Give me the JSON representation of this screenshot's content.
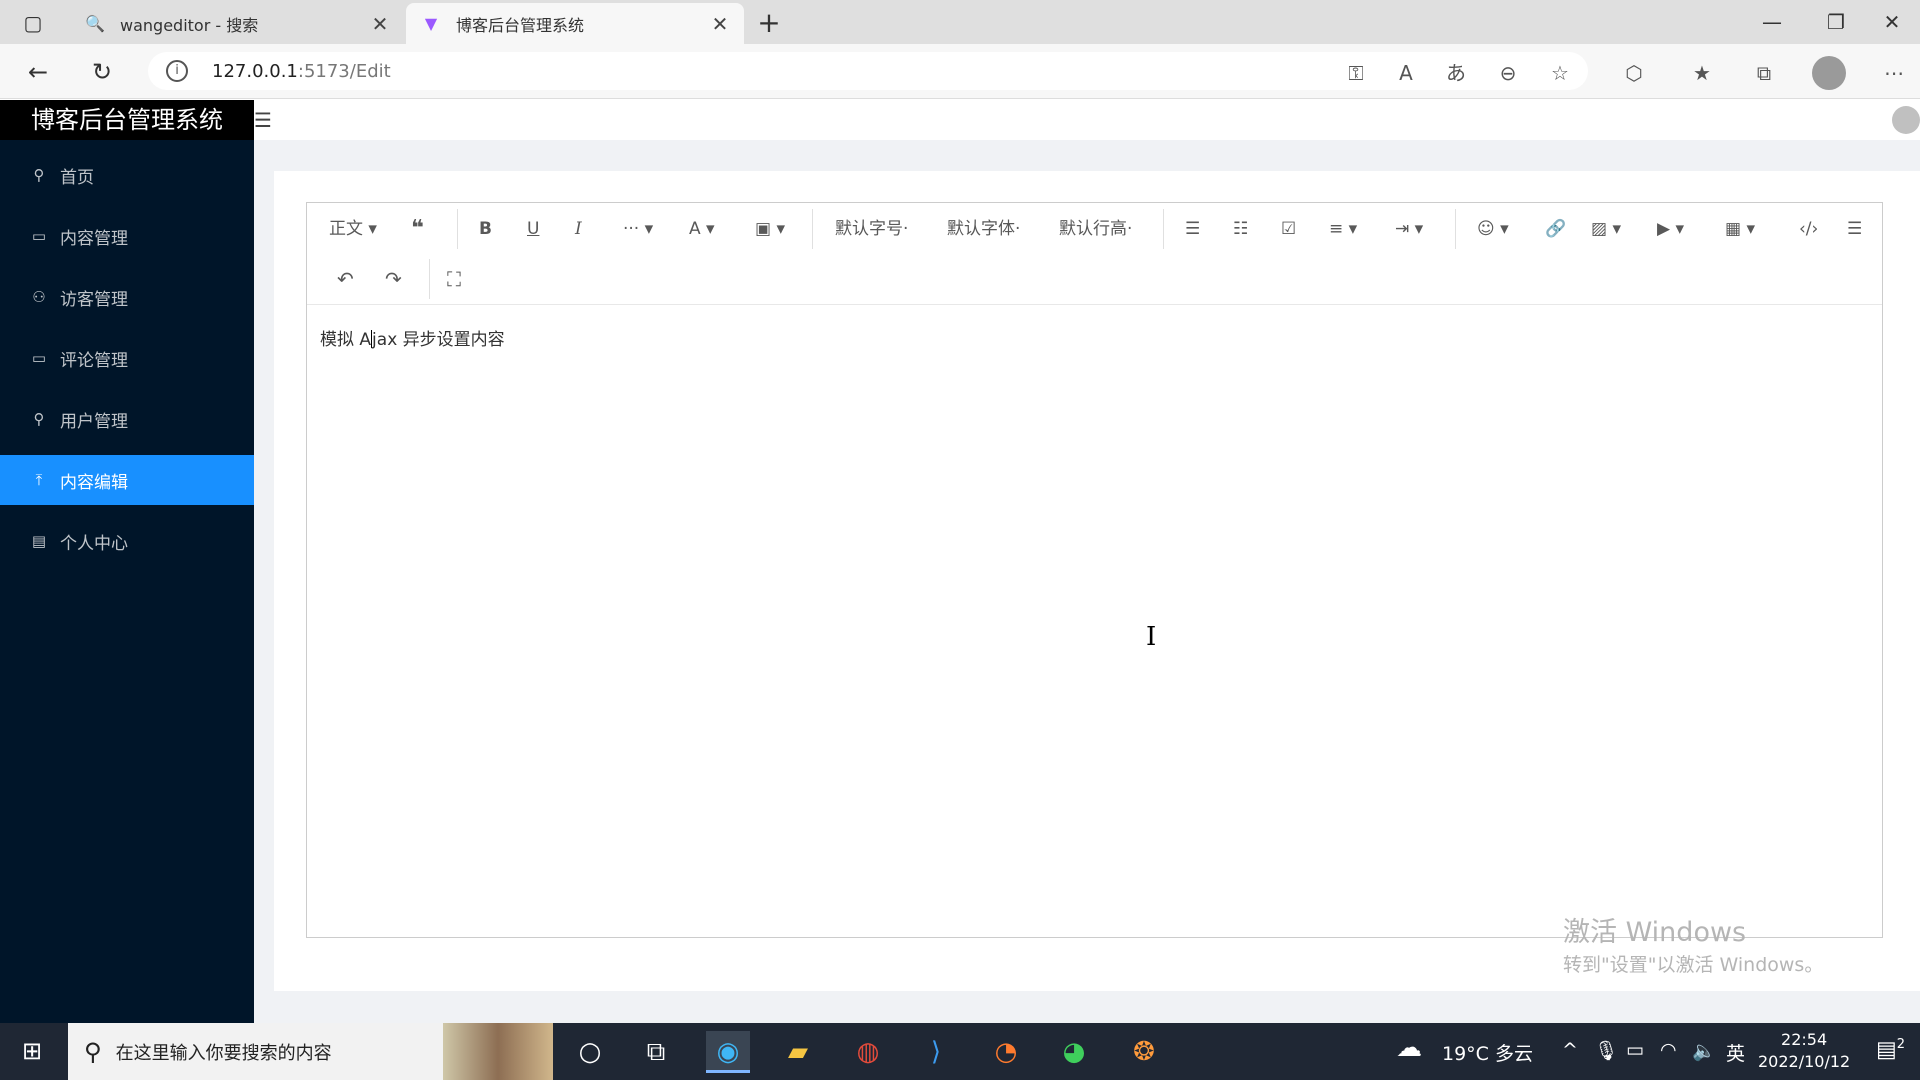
{
  "browser": {
    "tabs": [
      {
        "title": "wangeditor - 搜索",
        "icon": "search-icon"
      },
      {
        "title": "博客后台管理系统",
        "icon": "vite-icon"
      }
    ],
    "url": {
      "host": "127.0.0.1",
      "rest": ":5173/Edit"
    }
  },
  "app": {
    "brand": "博客后台管理系统",
    "menu": [
      {
        "label": "首页",
        "icon": "user-icon"
      },
      {
        "label": "内容管理",
        "icon": "video-icon"
      },
      {
        "label": "访客管理",
        "icon": "team-icon"
      },
      {
        "label": "评论管理",
        "icon": "desktop-icon"
      },
      {
        "label": "用户管理",
        "icon": "user-icon"
      },
      {
        "label": "内容编辑",
        "icon": "upload-icon",
        "active": true
      },
      {
        "label": "个人中心",
        "icon": "profile-icon"
      }
    ]
  },
  "editor": {
    "toolbar": {
      "heading": "正文",
      "font_size": "默认字号",
      "font_family": "默认字体",
      "line_height": "默认行高"
    },
    "content_before_caret": "模拟 A",
    "content_after_caret": "jax 异步设置内容"
  },
  "watermark": {
    "line1": "激活 Windows",
    "line2": "转到\"设置\"以激活 Windows。"
  },
  "taskbar": {
    "search_placeholder": "在这里输入你要搜索的内容",
    "weather": "19°C 多云",
    "ime": "英",
    "time": "22:54",
    "date": "2022/10/12",
    "notifications": "2"
  },
  "colors": {
    "sidebar": "#001529",
    "active": "#1890ff",
    "taskbar": "#1f2734"
  }
}
